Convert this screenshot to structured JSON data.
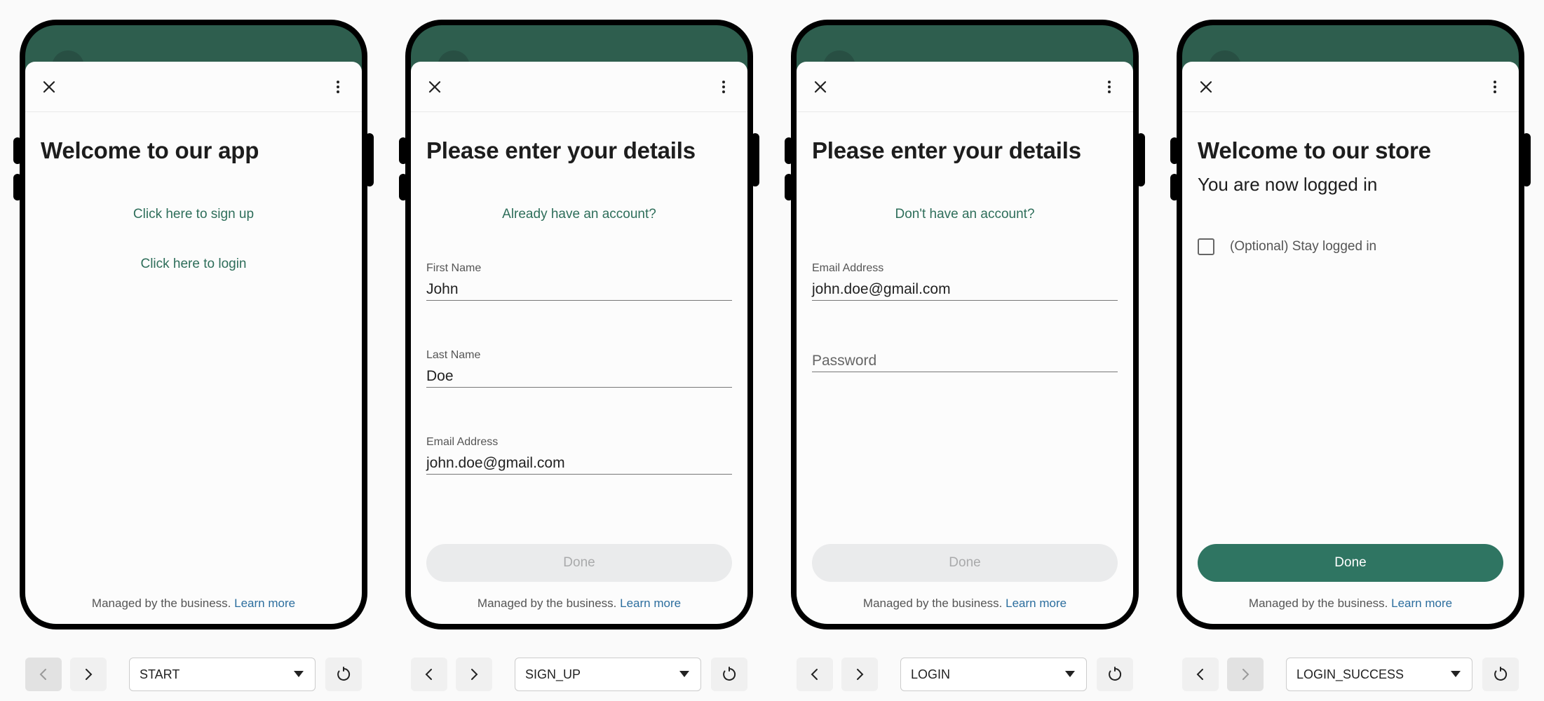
{
  "screens": [
    {
      "state": "START",
      "title": "Welcome to our app",
      "links": [
        "Click here to sign up",
        "Click here to login"
      ]
    },
    {
      "state": "SIGN_UP",
      "title": "Please enter your details",
      "link": "Already have an account?",
      "fields": [
        {
          "label": "First Name",
          "value": "John"
        },
        {
          "label": "Last Name",
          "value": "Doe"
        },
        {
          "label": "Email Address",
          "value": "john.doe@gmail.com"
        }
      ],
      "done_label": "Done"
    },
    {
      "state": "LOGIN",
      "title": "Please enter your details",
      "link": "Don't have an account?",
      "fields": [
        {
          "label": "Email Address",
          "value": "john.doe@gmail.com"
        },
        {
          "label": "",
          "placeholder": "Password"
        }
      ],
      "done_label": "Done"
    },
    {
      "state": "LOGIN_SUCCESS",
      "title": "Welcome to our store",
      "subtitle": "You are now logged in",
      "checkbox_label": "(Optional) Stay logged in",
      "done_label": "Done"
    }
  ],
  "footer": {
    "text": "Managed by the business.",
    "link": "Learn more"
  },
  "colors": {
    "header": "#2e5e4e",
    "accent": "#2f7562",
    "link": "#2e6e5a",
    "learn_more": "#2c6e9e"
  }
}
